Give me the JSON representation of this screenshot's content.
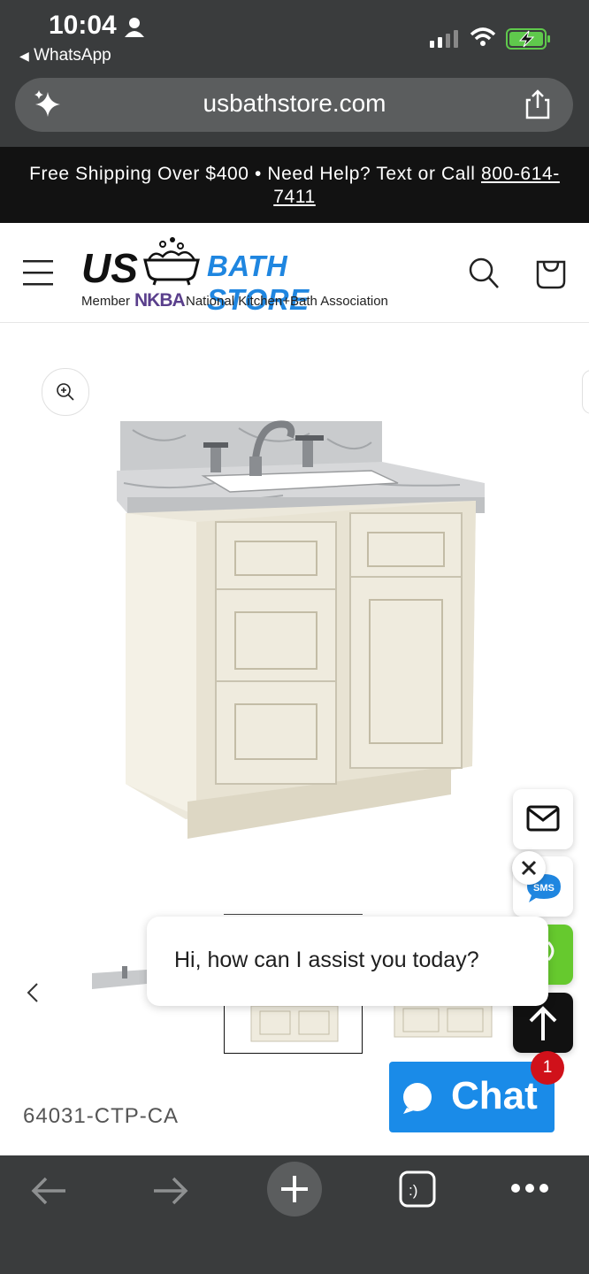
{
  "status_bar": {
    "time": "10:04",
    "back_app": "WhatsApp"
  },
  "browser": {
    "url": "usbathstore.com"
  },
  "announcement": {
    "text": "Free Shipping Over $400 • Need Help? Text or Call ",
    "phone": "800-614-7411"
  },
  "header": {
    "logo_us": "US",
    "logo_bath": "BATH STORE",
    "member_label": "Member",
    "nkba": "NKBA",
    "association": "National Kitchen+Bath Association"
  },
  "chat": {
    "bubble_text": "Hi, how can I assist you today?",
    "button_label": "Chat",
    "badge_count": "1"
  },
  "side_buttons": {
    "sms_label": "SMS"
  },
  "product": {
    "sku": "64031-CTP-CA"
  },
  "icons": [
    "sparkle-icon",
    "share-icon",
    "menu-icon",
    "search-icon",
    "cart-icon",
    "zoom-icon",
    "mail-icon",
    "close-icon",
    "sms-icon",
    "phone-icon",
    "arrow-up-icon",
    "chat-icon",
    "chevron-left-icon",
    "back-arrow-icon",
    "forward-arrow-icon",
    "plus-icon",
    "tabs-icon",
    "more-icon"
  ],
  "colors": {
    "brand_blue": "#1a8be8",
    "nkba_purple": "#5a3f8c",
    "chat_blue": "#1a8be8",
    "sms_green": "#66c92e",
    "badge_red": "#d0111a"
  }
}
